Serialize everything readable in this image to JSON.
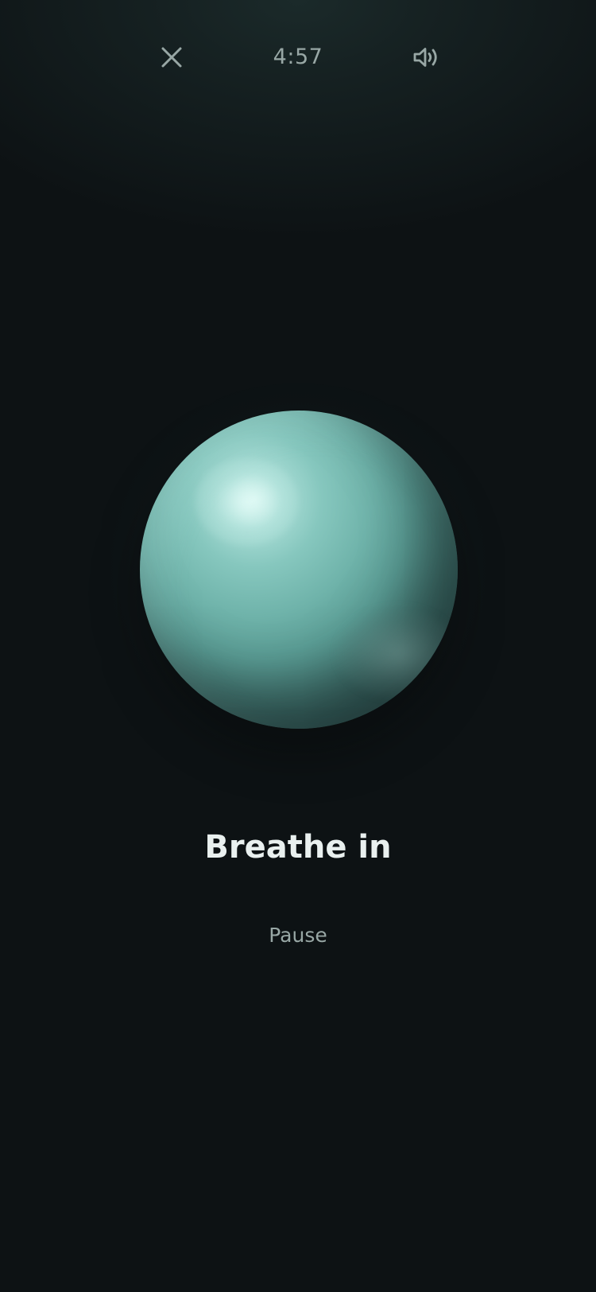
{
  "header": {
    "close_icon": "close-icon",
    "timer": "4:57",
    "sound_icon": "speaker-icon"
  },
  "exercise": {
    "instruction": "Breathe in",
    "pause_label": "Pause"
  },
  "colors": {
    "background": "#0d1214",
    "orb_accent": "#6fb3aa",
    "text_primary": "#e9f0ef",
    "text_secondary": "#98a7a5"
  }
}
